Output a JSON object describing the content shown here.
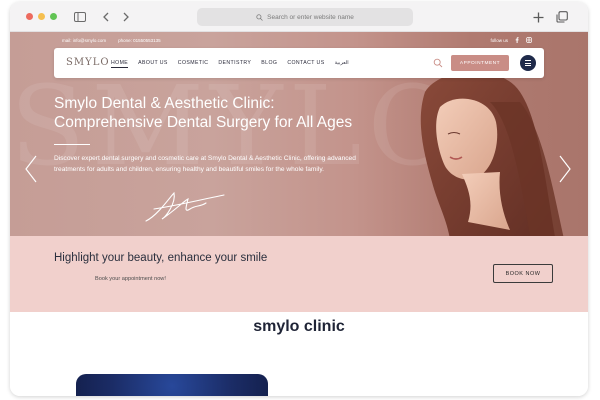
{
  "browser": {
    "address_placeholder": "Search or enter website name"
  },
  "topbar": {
    "mail": "mail: info@smylo.com",
    "phone": "phone: 01550553135",
    "follow": "follow us"
  },
  "header": {
    "logo": "SMYLO",
    "nav": [
      "HOME",
      "ABOUT US",
      "COSMETIC",
      "DENTISTRY",
      "BLOG",
      "CONTACT US",
      "العربية"
    ],
    "appointment_label": "APPOINTMENT"
  },
  "hero": {
    "watermark": "SMYLO",
    "title_line1": "Smylo Dental & Aesthetic Clinic:",
    "title_line2": "Comprehensive Dental Surgery for All Ages",
    "description": "Discover expert dental surgery and cosmetic care at Smylo Dental & Aesthetic Clinic, offering advanced treatments for adults and children, ensuring healthy and beautiful smiles for the whole family."
  },
  "band": {
    "title": "Highlight your beauty, enhance your smile",
    "subtitle": "Book your appointment now!",
    "book_label": "BOOK NOW"
  },
  "section": {
    "title": "smylo clinic"
  },
  "colors": {
    "accent": "#c98d86",
    "navy": "#1f2a4a",
    "band": "#f1d0cc"
  },
  "icons": [
    "sidebar-toggle-icon",
    "back-icon",
    "forward-icon",
    "new-tab-icon",
    "tabs-overview-icon",
    "search-icon",
    "facebook-icon",
    "instagram-icon",
    "menu-icon",
    "arrow-left-icon",
    "arrow-right-icon",
    "signature-icon"
  ]
}
